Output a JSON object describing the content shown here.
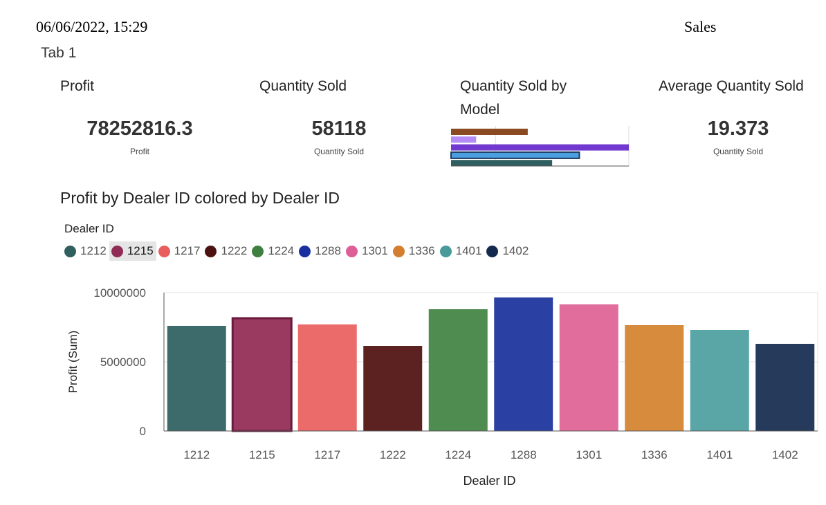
{
  "header": {
    "datetime": "06/06/2022, 15:29",
    "title": "Sales"
  },
  "tab": {
    "label": "Tab 1"
  },
  "kpis": {
    "profit": {
      "title": "Profit",
      "value": "78252816.3",
      "caption": "Profit"
    },
    "quantity": {
      "title": "Quantity Sold",
      "value": "58118",
      "caption": "Quantity Sold"
    },
    "by_model": {
      "title_line1": "Quantity Sold by",
      "title_line2": "Model"
    },
    "average": {
      "title": "Average Quantity Sold",
      "value": "19.373",
      "caption": "Quantity Sold"
    }
  },
  "mini_chart_data": {
    "type": "bar",
    "orientation": "horizontal",
    "values": [
      11000,
      3600,
      25500,
      18400,
      14500
    ],
    "colors": [
      "#8a4a22",
      "#b38cf5",
      "#7139cf",
      "#4a9fe0",
      "#2f5f60"
    ],
    "highlighted_index": 3,
    "xlim": [
      0,
      25500
    ]
  },
  "chart_data": {
    "type": "bar",
    "title": "Profit by Dealer ID colored by Dealer ID",
    "legend_title": "Dealer ID",
    "xlabel": "Dealer ID",
    "ylabel": "Profit (Sum)",
    "categories": [
      "1212",
      "1215",
      "1217",
      "1222",
      "1224",
      "1288",
      "1301",
      "1336",
      "1401",
      "1402"
    ],
    "values": [
      7600000,
      8150000,
      7700000,
      6150000,
      8800000,
      9650000,
      9150000,
      7650000,
      7300000,
      6300000
    ],
    "colors": [
      "#3d6b6b",
      "#9b3a60",
      "#eb6b6b",
      "#5c2222",
      "#4f8c50",
      "#2a40a2",
      "#e16d9c",
      "#d78b3c",
      "#5aa6a6",
      "#263b5c"
    ],
    "legend_dot_colors": [
      "#2f5f5e",
      "#8f2b55",
      "#e85d5d",
      "#4c1212",
      "#3f7f3f",
      "#1a2fa0",
      "#dd5f96",
      "#d47f2f",
      "#4a9a9a",
      "#132a4e"
    ],
    "selected_category": "1215",
    "yticks": [
      "10000000",
      "5000000",
      "0"
    ],
    "ylim": [
      0,
      10000000
    ],
    "legend_placement": "top-left",
    "grid": true
  }
}
